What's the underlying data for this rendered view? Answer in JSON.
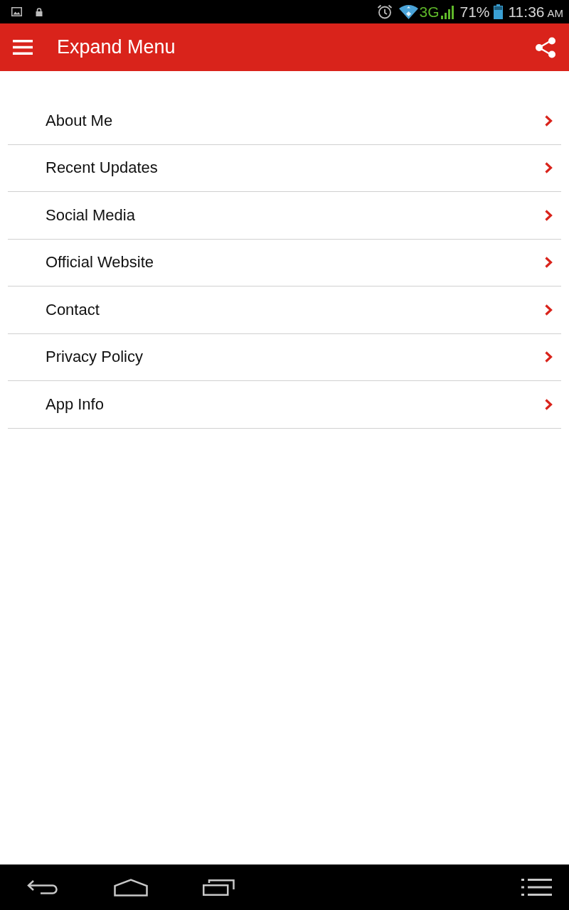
{
  "status_bar": {
    "network": "3G",
    "battery": "71%",
    "time": "11:36",
    "meridiem": "AM"
  },
  "app_bar": {
    "title": "Expand Menu"
  },
  "menu": {
    "items": [
      {
        "label": "About Me"
      },
      {
        "label": "Recent Updates"
      },
      {
        "label": "Social Media"
      },
      {
        "label": "Official Website"
      },
      {
        "label": "Contact"
      },
      {
        "label": "Privacy Policy"
      },
      {
        "label": "App Info"
      }
    ]
  }
}
